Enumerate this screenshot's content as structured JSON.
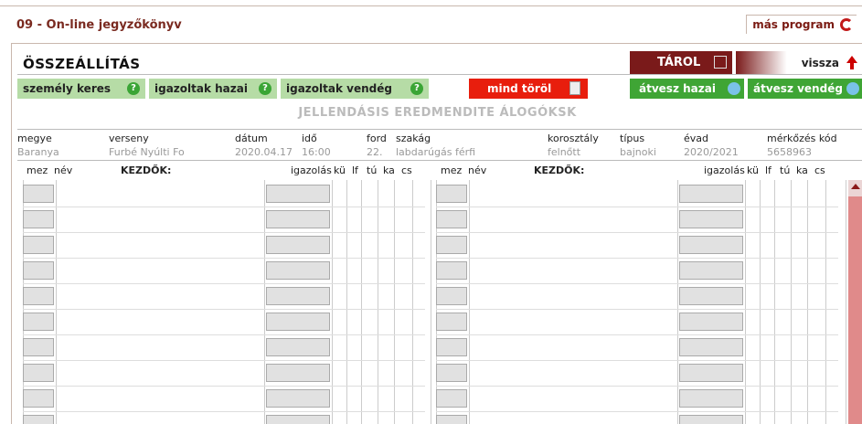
{
  "app": {
    "title": "09 - On-line jegyzőkönyv",
    "other_program": "más program"
  },
  "section": {
    "title": "ÖSSZEÁLLÍTÁS"
  },
  "actions": {
    "store": "TÁROL",
    "back": "vissza"
  },
  "buttons": {
    "person_search": "személy keres",
    "home_verified": "igazoltak hazai",
    "guest_verified": "igazoltak vendég",
    "delete_all": "mind töröl",
    "take_home": "átvesz hazai",
    "take_guest": "átvesz vendég"
  },
  "ghost_text": "JELLENDÁSIS EREDMENDITE ÁLOGÓKSK",
  "info": {
    "headers": [
      "megye",
      "verseny",
      "dátum",
      "idő",
      "ford",
      "szakág",
      "korosztály",
      "típus",
      "évad",
      "mérkőzés kód"
    ],
    "values": [
      "Baranya",
      "Furbé Nyúlti Fo",
      "2020.04.17",
      "16:00",
      "22.",
      "labdarúgás férfi",
      "felnőtt",
      "bajnoki",
      "2020/2021",
      "5658963"
    ]
  },
  "table": {
    "col_mez": "mez",
    "col_nev": "név",
    "starters": "KEZDŐK:",
    "col_igazolas": "igazolás",
    "col_ku": "kü",
    "col_lf": "lf",
    "col_tu": "tú",
    "col_ka": "ka",
    "col_cs": "cs"
  },
  "colors": {
    "brand": "#7a1a1a",
    "accent_red": "#e81e0d",
    "light_green": "#b6dca6",
    "dark_green": "#3fa535"
  }
}
